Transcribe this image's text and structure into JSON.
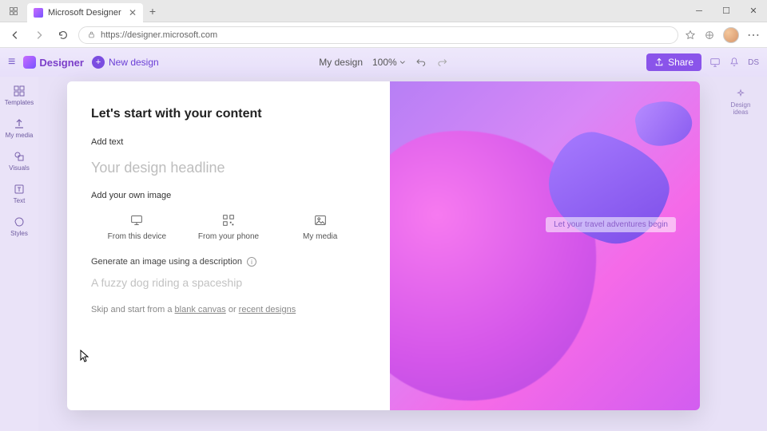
{
  "browser": {
    "tab_title": "Microsoft Designer",
    "url": "https://designer.microsoft.com"
  },
  "app": {
    "brand": "Designer",
    "new_design": "New design",
    "doc_title": "My design",
    "zoom": "100%",
    "share": "Share",
    "user_initials": "DS"
  },
  "rail": {
    "templates": "Templates",
    "mymedia": "My media",
    "visuals": "Visuals",
    "text": "Text",
    "styles": "Styles",
    "design_ideas": "Design ideas"
  },
  "modal": {
    "title": "Let's start with your content",
    "add_text_label": "Add text",
    "headline_placeholder": "Your design headline",
    "add_image_label": "Add your own image",
    "from_device": "From this device",
    "from_phone": "From your phone",
    "my_media": "My media",
    "gen_label": "Generate an image using a description",
    "gen_placeholder": "A fuzzy dog riding a spaceship",
    "skip_prefix": "Skip and start from a ",
    "skip_blank": "blank canvas",
    "skip_or": " or ",
    "skip_recent": "recent designs",
    "preview_overlay": "Let your travel adventures begin"
  }
}
